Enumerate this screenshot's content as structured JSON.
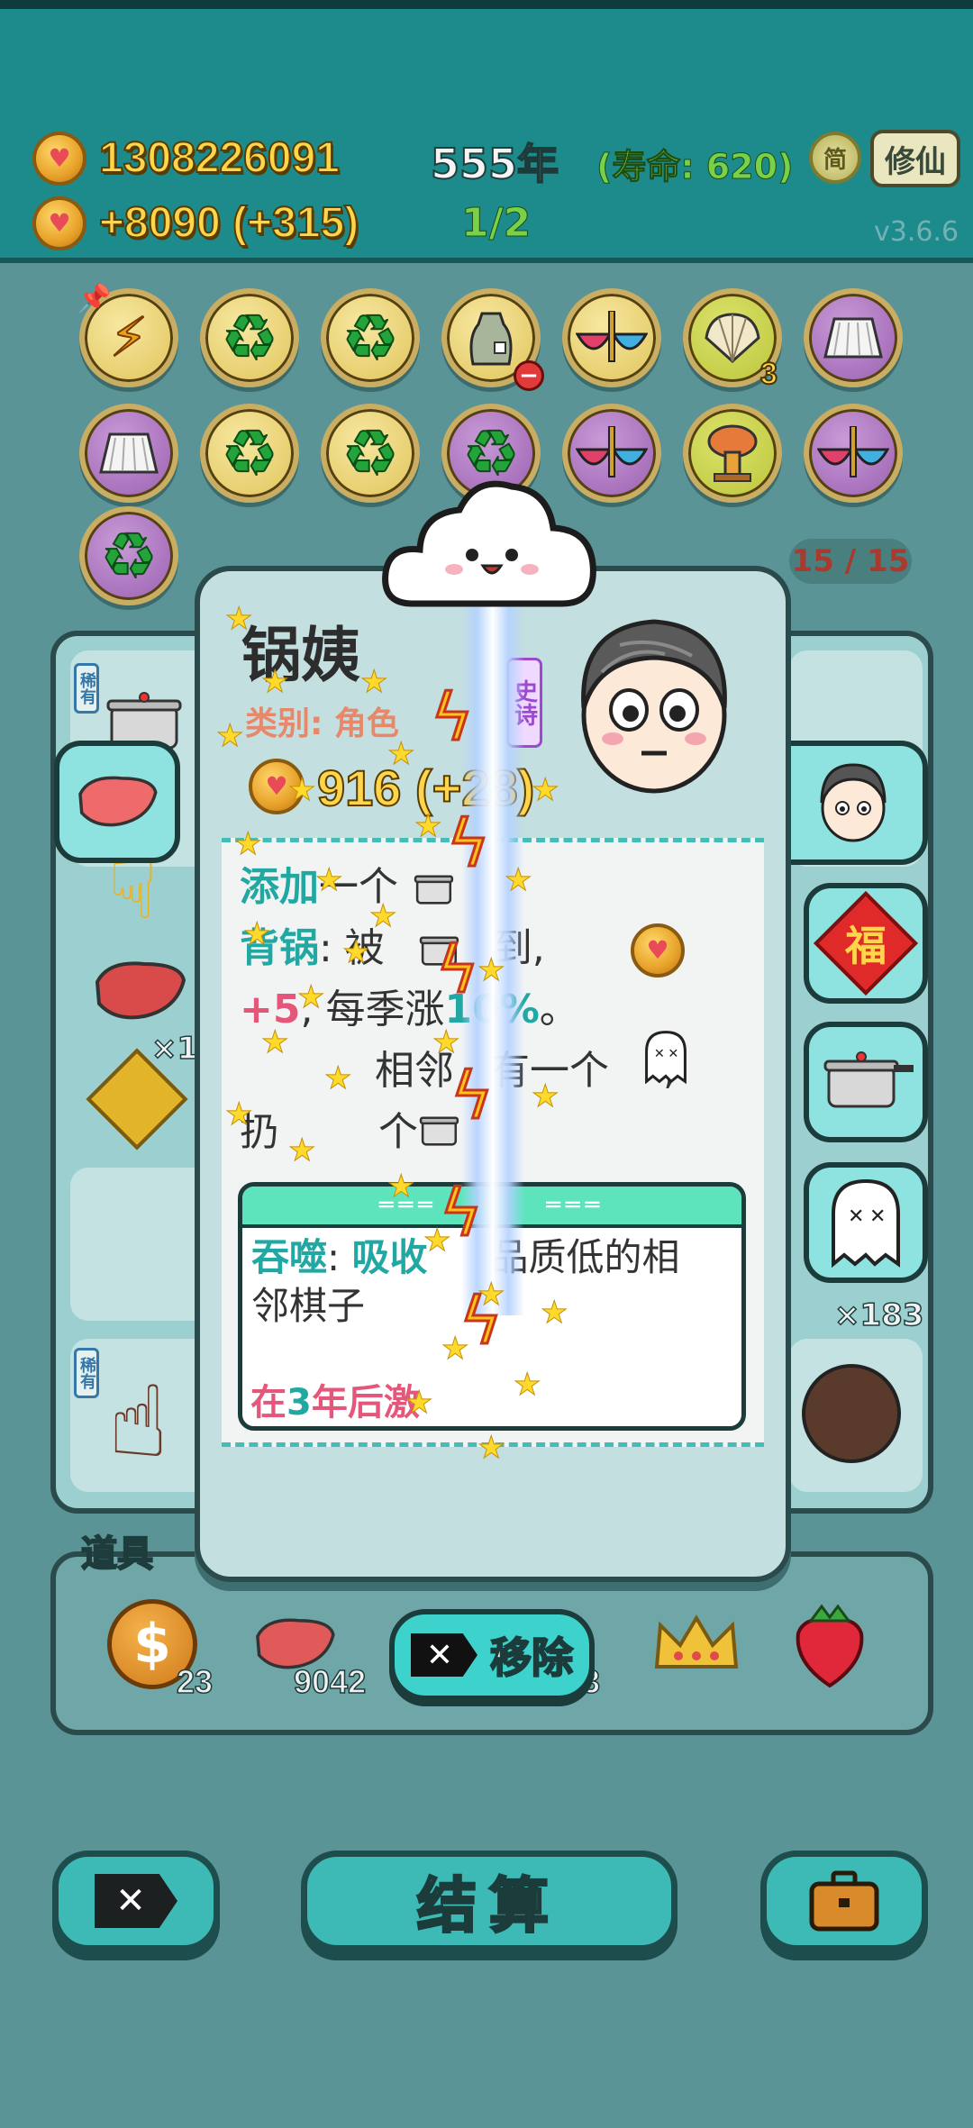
{
  "topbar": {
    "gold": "1308226091",
    "income": "+8090 (+315)",
    "year": "555年",
    "lifespan": "(寿命: 620)",
    "round": "1/2",
    "jian_label": "简",
    "xiuxian_label": "修仙",
    "version": "v3.6.6"
  },
  "relics": {
    "shell_count": "3",
    "capacity": "15 / 15",
    "icons": [
      "lightning-pin",
      "recycle",
      "recycle",
      "garbage-bag",
      "noodle-bowls",
      "shell",
      "skirt",
      "skirt",
      "recycle",
      "recycle",
      "recycle",
      "noodle-bowls",
      "mushroom-cloud",
      "noodle-bowls",
      "recycle"
    ]
  },
  "board": {
    "rare_tag": "稀有",
    "ghost_count": "×183",
    "heart_count": "×1"
  },
  "card": {
    "name": "锅姨",
    "type": "类别: 角色",
    "rarity": "史诗",
    "value": "916 (+28)",
    "desc": {
      "l1_kw": "添加",
      "l1_rest": "一个",
      "l2_kw": "背锅",
      "l2_rest": ": 被",
      "l2_rest2": "到,",
      "l3_kw": "+5",
      "l3_rest": ", 每季涨",
      "l3_pct": "10%",
      "l3_end": "。",
      "l4_a": "",
      "l4_b": "相邻",
      "l4_c": "有一个",
      "l4_d": ",",
      "l5_a": "扔",
      "l5_b": "个"
    },
    "skill": {
      "name": "吞噬",
      "colon": ":",
      "kw": "吸收",
      "rest": "品质低的相",
      "rest2": "邻棋子",
      "foot_a": "在",
      "foot_num": "3",
      "foot_b": "年后激"
    },
    "remove_label": "移除"
  },
  "tray": {
    "title": "道具",
    "items": [
      {
        "icon": "dollar-coin",
        "count": "23"
      },
      {
        "icon": "liver",
        "count": "9042"
      },
      {
        "icon": "hidden-item",
        "count": ""
      },
      {
        "icon": "hidden-item-2",
        "count": "3"
      },
      {
        "icon": "crown",
        "count": ""
      },
      {
        "icon": "strawberry",
        "count": ""
      }
    ]
  },
  "bottom": {
    "settle_label": "结算"
  }
}
